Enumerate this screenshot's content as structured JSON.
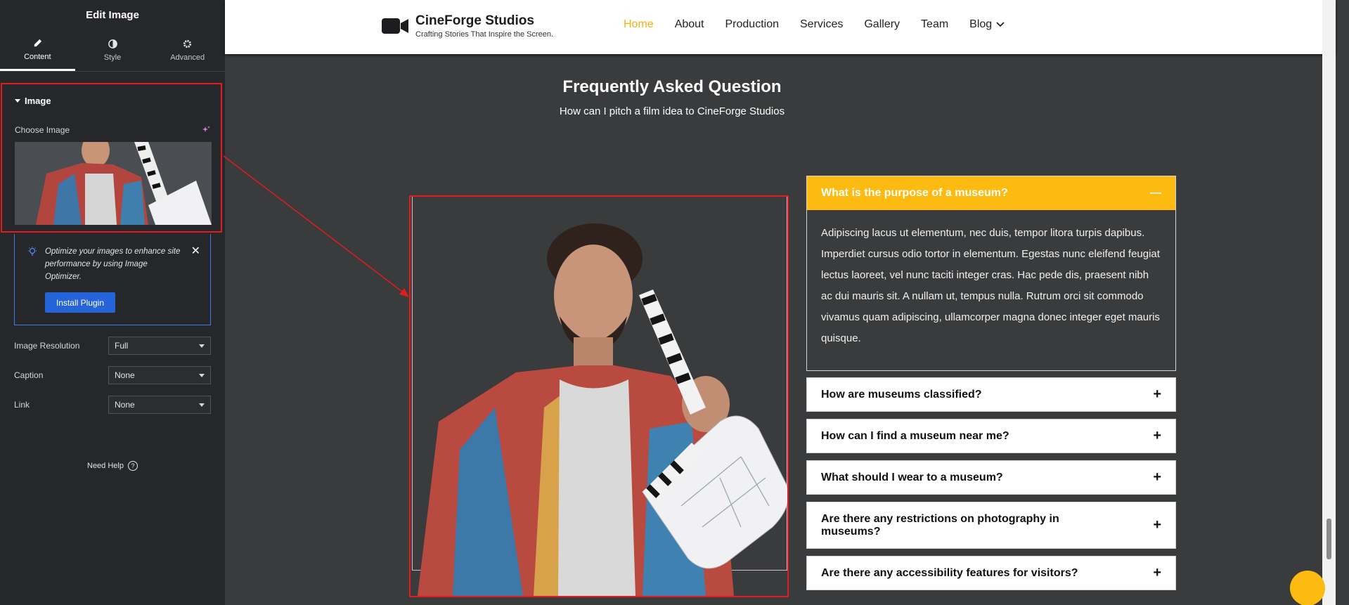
{
  "panel": {
    "title": "Edit Image",
    "tabs": [
      {
        "label": "Content",
        "icon": "pencil-icon"
      },
      {
        "label": "Style",
        "icon": "contrast-icon"
      },
      {
        "label": "Advanced",
        "icon": "gear-icon"
      }
    ],
    "section_title": "Image",
    "choose_image_label": "Choose Image",
    "notice": {
      "text": "Optimize your images to enhance site performance by using Image Optimizer.",
      "button": "Install Plugin"
    },
    "fields": [
      {
        "label": "Image Resolution",
        "value": "Full"
      },
      {
        "label": "Caption",
        "value": "None"
      },
      {
        "label": "Link",
        "value": "None"
      }
    ],
    "need_help": "Need Help"
  },
  "site": {
    "brand": {
      "name": "CineForge Studios",
      "tagline": "Crafting Stories That Inspire the Screen."
    },
    "nav": [
      {
        "label": "Home",
        "active": true
      },
      {
        "label": "About"
      },
      {
        "label": "Production"
      },
      {
        "label": "Services"
      },
      {
        "label": "Gallery"
      },
      {
        "label": "Team"
      },
      {
        "label": "Blog",
        "dropdown": true
      }
    ],
    "faq": {
      "heading": "Frequently Asked Question",
      "subheading": "How can I pitch a film idea to CineForge Studios",
      "open_item": {
        "question": "What is the purpose of a museum?",
        "answer": "Adipiscing lacus ut elementum, nec duis, tempor litora turpis dapibus. Imperdiet cursus odio tortor in elementum. Egestas nunc eleifend feugiat lectus laoreet, vel nunc taciti integer cras. Hac pede dis, praesent nibh ac dui mauris sit. A nullam ut, tempus nulla. Rutrum orci sit commodo vivamus quam adipiscing, ullamcorper magna donec integer eget mauris quisque."
      },
      "items": [
        "How are museums classified?",
        "How can I find a museum near me?",
        "What should I wear to a museum?",
        "Are there any restrictions on photography in museums?",
        "Are there any accessibility features for visitors?"
      ]
    }
  },
  "colors": {
    "accent": "#fdba10",
    "highlight": "#e01d1d",
    "button": "#2563d9"
  }
}
